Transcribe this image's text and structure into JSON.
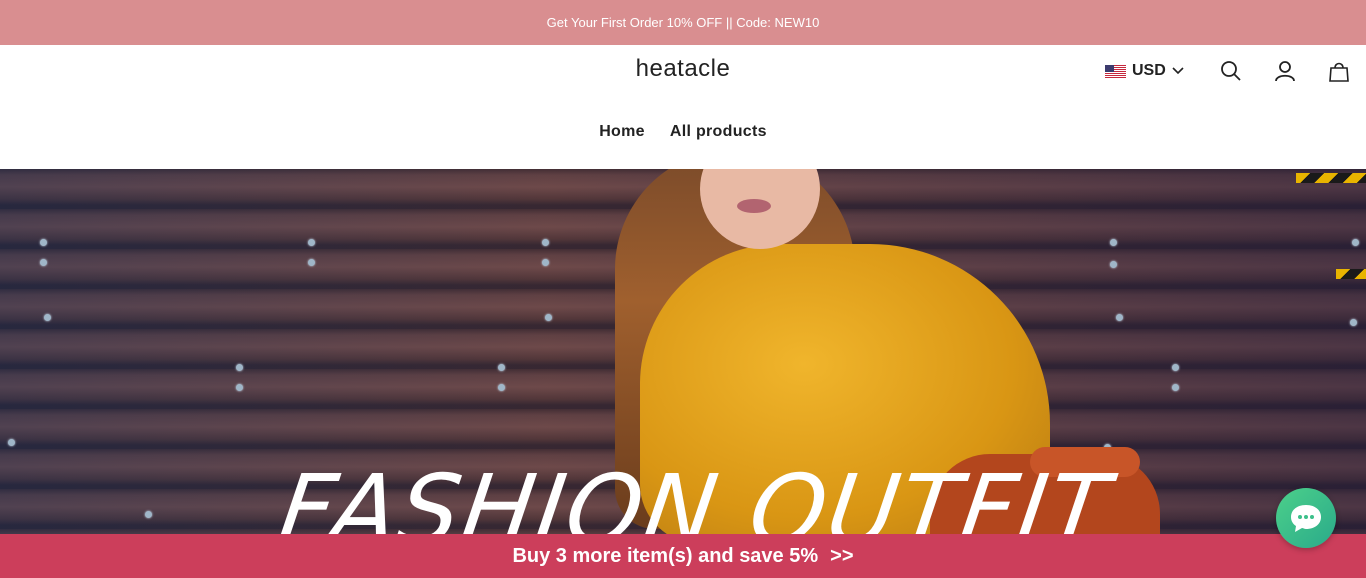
{
  "announcement": {
    "text": "Get Your First Order 10% OFF || Code: NEW10"
  },
  "header": {
    "logo": "heatacle",
    "currency": {
      "selected": "USD",
      "flag": "us-flag-icon"
    },
    "icons": [
      "search-icon",
      "account-icon",
      "cart-icon"
    ]
  },
  "nav": {
    "items": [
      {
        "label": "Home"
      },
      {
        "label": "All products"
      }
    ]
  },
  "hero": {
    "headline": "FASHION OUTFIT"
  },
  "promo_bar": {
    "text": "Buy 3 more item(s) and save 5%",
    "arrow": ">>"
  },
  "colors": {
    "announcement_bg": "#d98e90",
    "promo_bg": "#cc3e5b",
    "chat_bg": "#3cc08a"
  }
}
